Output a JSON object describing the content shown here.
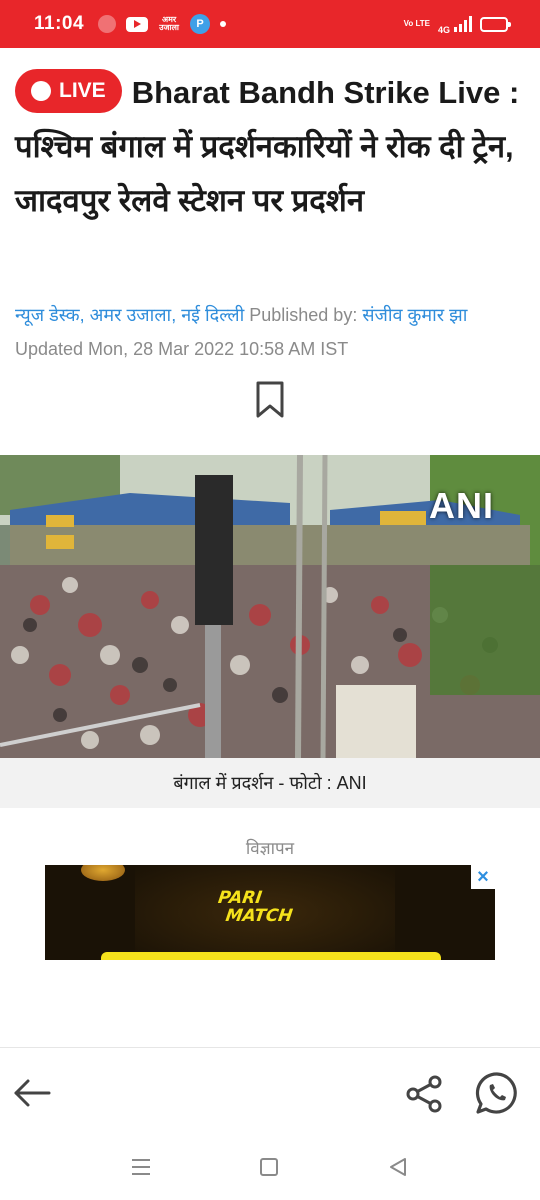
{
  "status_bar": {
    "time": "11:04",
    "amar_ujala_badge": "अमर उजाला",
    "p_app_badge": "P",
    "volte": "Vo LTE",
    "network": "4G"
  },
  "article": {
    "live_badge": "LIVE",
    "headline": "Bharat Bandh Strike Live : पश्चिम बंगाल में प्रदर्शनकारियों ने रोक दी ट्रेन, जादवपुर रेलवे स्टेशन पर प्रदर्शन",
    "author": "न्यूज डेस्क, अमर उजाला, नई दिल्ली",
    "published_by_label": "Published by:",
    "publisher": "संजीव कुमार झा",
    "updated": "Updated Mon, 28 Mar 2022 10:58 AM IST",
    "photo_watermark": "ANI",
    "photo_caption": "बंगाल में प्रदर्शन  - फोटो : ANI"
  },
  "ad": {
    "label": "विज्ञापन",
    "close": "×",
    "brand_line1": "PARI",
    "brand_line2": "MATCH"
  },
  "colors": {
    "brand_red": "#e8262a",
    "link_blue": "#2f8ddb",
    "muted_gray": "#8a8a8a"
  },
  "icons": {
    "bookmark": "bookmark-icon",
    "back": "back-arrow-icon",
    "share": "share-icon",
    "whatsapp": "whatsapp-icon"
  }
}
